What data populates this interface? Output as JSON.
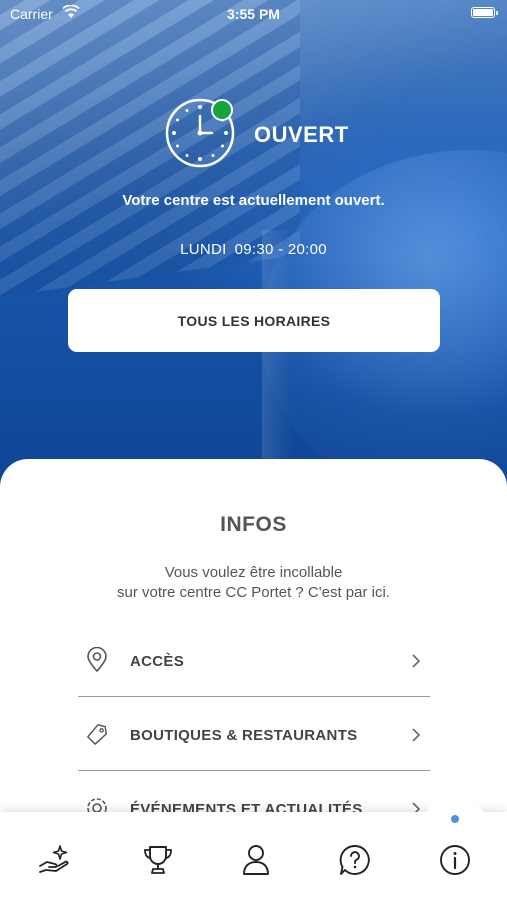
{
  "status_bar": {
    "carrier": "Carrier",
    "time": "3:55 PM"
  },
  "status": {
    "state_label": "OUVERT",
    "description": "Votre centre est actuellement ouvert.",
    "day": "LUNDI",
    "hours": "09:30 - 20:00",
    "all_hours_button": "TOUS LES HORAIRES",
    "indicator_color": "#17a33b"
  },
  "infos": {
    "title": "INFOS",
    "desc_line1": "Vous voulez être incollable",
    "desc_line2": "sur votre centre CC Portet ? C'est par ici.",
    "items": [
      {
        "label": "ACCÈS",
        "icon": "location-pin-icon"
      },
      {
        "label": "BOUTIQUES & RESTAURANTS",
        "icon": "tag-icon"
      },
      {
        "label": "ÉVÉNEMENTS ET ACTUALITÉS",
        "icon": "event-icon"
      }
    ]
  },
  "tabbar": {
    "tabs": [
      {
        "icon": "hand-sparkle-icon"
      },
      {
        "icon": "trophy-icon"
      },
      {
        "icon": "profile-icon"
      },
      {
        "icon": "help-icon"
      },
      {
        "icon": "info-icon",
        "active": true
      }
    ],
    "active_color": "#4a90e2"
  }
}
